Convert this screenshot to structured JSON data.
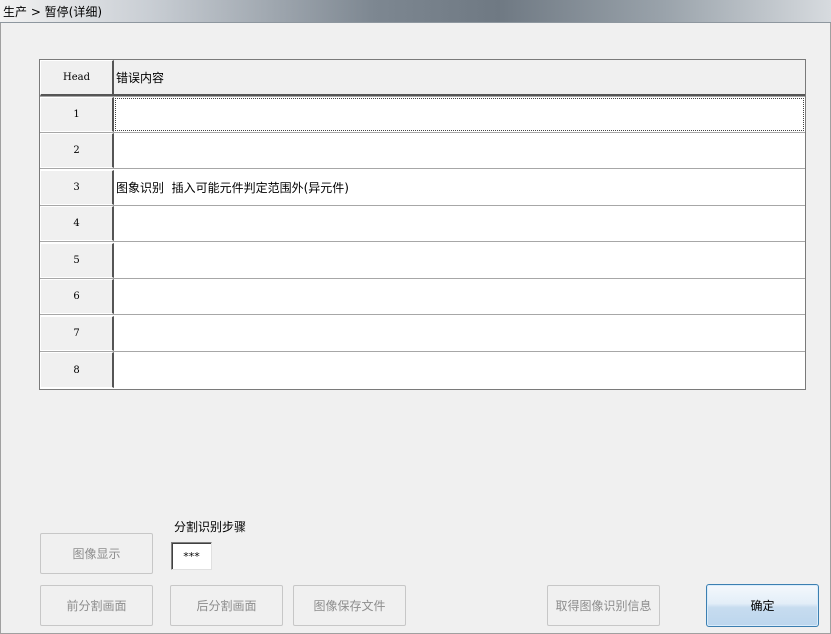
{
  "window": {
    "title": "生产 > 暂停(详细)"
  },
  "grid": {
    "header": {
      "head": "Head",
      "content": "错误内容"
    },
    "rows": [
      {
        "head": "1",
        "content": ""
      },
      {
        "head": "2",
        "content": ""
      },
      {
        "head": "3",
        "content": "图象识别  插入可能元件判定范围外(异元件)"
      },
      {
        "head": "4",
        "content": ""
      },
      {
        "head": "5",
        "content": ""
      },
      {
        "head": "6",
        "content": ""
      },
      {
        "head": "7",
        "content": ""
      },
      {
        "head": "8",
        "content": ""
      }
    ]
  },
  "step": {
    "label": "分割识别步骤",
    "value": "***"
  },
  "buttons": {
    "image_display": "图像显示",
    "prev_split": "前分割画面",
    "next_split": "后分割画面",
    "save_image": "图像保存文件",
    "get_recognition": "取得图像识别信息",
    "ok": "确定"
  }
}
